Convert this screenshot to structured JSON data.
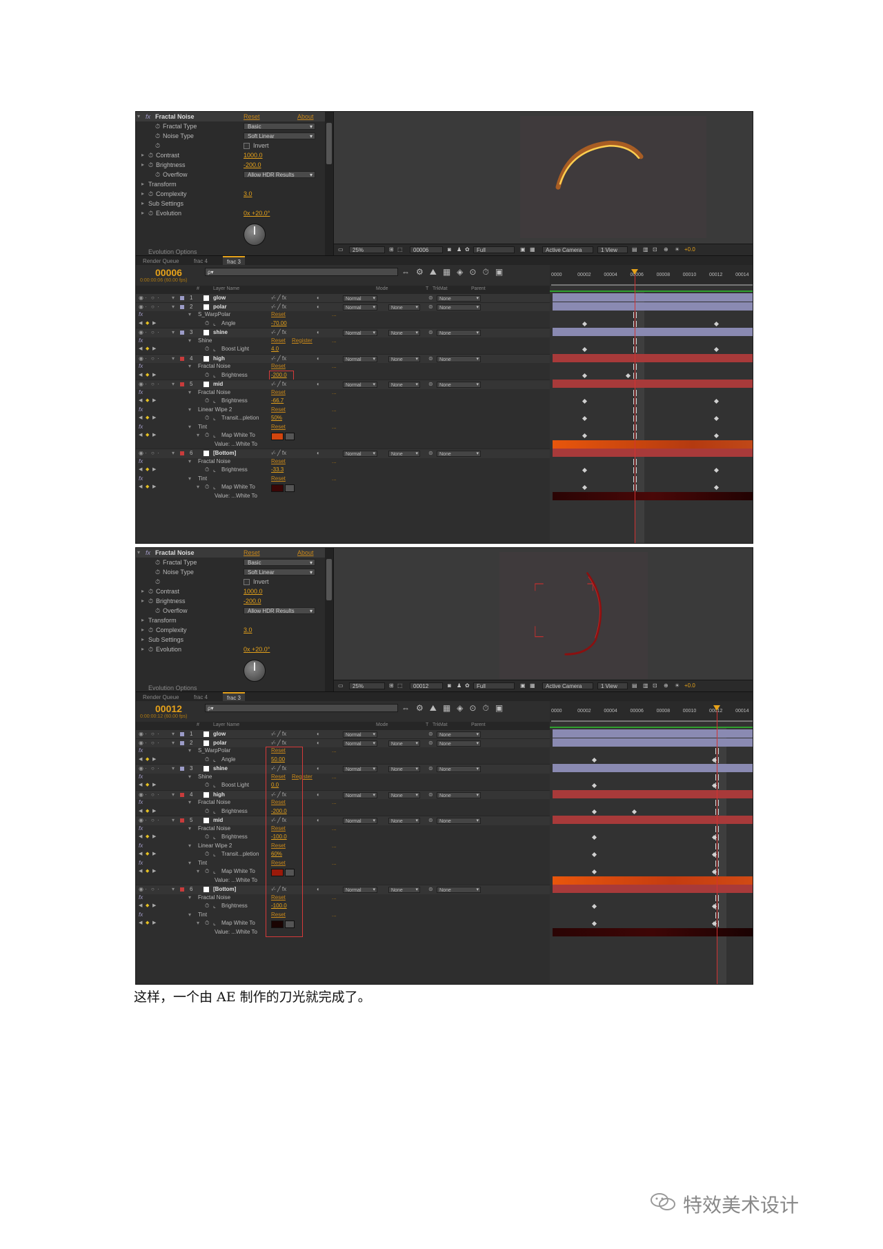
{
  "caption": "这样，一个由 AE 制作的刀光就完成了。",
  "watermark": "特效美术设计",
  "screens": [
    {
      "effect": {
        "title": "Fractal Noise",
        "reset": "Reset",
        "about": "About",
        "fractal_type_label": "Fractal Type",
        "fractal_type": "Basic",
        "noise_type_label": "Noise Type",
        "noise_type": "Soft Linear",
        "invert_label": "Invert",
        "contrast_label": "Contrast",
        "contrast": "1000.0",
        "brightness_label": "Brightness",
        "brightness": "-200.0",
        "overflow_label": "Overflow",
        "overflow": "Allow HDR Results",
        "transform_label": "Transform",
        "complexity_label": "Complexity",
        "complexity": "3.0",
        "sub_settings_label": "Sub Settings",
        "evolution_label": "Evolution",
        "evolution": "0x +20.0°",
        "evolution_options_label": "Evolution Options"
      },
      "viewer": {
        "zoom": "25%",
        "frame": "00006",
        "resolution": "Full",
        "camera": "Active Camera",
        "view": "1 View",
        "exposure": "+0.0"
      },
      "tabs": [
        "Render Queue",
        "frac 4",
        "frac 3"
      ],
      "timeline": {
        "timecode": "00006",
        "timecode_sub": "0:00:00:06 (60.00 fps)",
        "search": "ρ▾",
        "cols": {
          "layer_name": "Layer Name",
          "mode": "Mode",
          "t": "T",
          "trkmat": "TrkMat",
          "parent": "Parent",
          "num": "#"
        },
        "ruler": [
          "0000",
          "00002",
          "00004",
          "00006",
          "00008",
          "00010",
          "00012",
          "00014"
        ],
        "rows": [
          {
            "kind": "layer",
            "num": "1",
            "name": "glow",
            "color": "#9c9cc8",
            "mode": "Normal",
            "trk": "",
            "parent": "None",
            "bar": "#8a8ab2"
          },
          {
            "kind": "layer",
            "num": "2",
            "name": "polar",
            "color": "#9c9cc8",
            "mode": "Normal",
            "trk": "None",
            "parent": "None",
            "bar": "#8a8ab2"
          },
          {
            "kind": "effect",
            "name": "S_WarpPolar",
            "reset": "Reset",
            "extra": "",
            "dots": "..."
          },
          {
            "kind": "prop",
            "name": "Angle",
            "value": "-70.00",
            "kf": [
              0.15,
              0.81
            ]
          },
          {
            "kind": "layer",
            "num": "3",
            "name": "shine",
            "color": "#9c9cc8",
            "mode": "Normal",
            "trk": "None",
            "parent": "None",
            "bar": "#8a8ab2"
          },
          {
            "kind": "effect",
            "name": "Shine",
            "reset": "Reset",
            "extra": "Register",
            "dots": "..."
          },
          {
            "kind": "prop",
            "name": "Boost Light",
            "value": "4.0",
            "kf": [
              0.15,
              0.81
            ]
          },
          {
            "kind": "layer",
            "num": "4",
            "name": "high",
            "color": "#c83c3c",
            "mode": "Normal",
            "trk": "None",
            "parent": "None",
            "bar": "#a83a3a"
          },
          {
            "kind": "effect",
            "name": "Fractal Noise",
            "reset": "Reset",
            "extra": "",
            "dots": "..."
          },
          {
            "kind": "prop",
            "name": "Brightness",
            "value": "-200.0",
            "kf": [
              0.15,
              0.37
            ],
            "boxed": true
          },
          {
            "kind": "layer",
            "num": "5",
            "name": "mid",
            "color": "#c83c3c",
            "mode": "Normal",
            "trk": "None",
            "parent": "None",
            "bar": "#a83a3a"
          },
          {
            "kind": "effect",
            "name": "Fractal Noise",
            "reset": "Reset",
            "extra": "",
            "dots": "..."
          },
          {
            "kind": "prop",
            "name": "Brightness",
            "value": "-66.7",
            "kf": [
              0.15,
              0.81
            ]
          },
          {
            "kind": "effect",
            "name": "Linear Wipe 2",
            "reset": "Reset",
            "extra": "",
            "dots": "..."
          },
          {
            "kind": "prop",
            "name": "Transit...pletion",
            "value": "50%",
            "kf": [
              0.15,
              0.81
            ]
          },
          {
            "kind": "effect",
            "name": "Tint",
            "reset": "Reset",
            "extra": "",
            "dots": "..."
          },
          {
            "kind": "swatch",
            "name": "Map White To",
            "color": "#d2450e",
            "kf": [
              0.15,
              0.81
            ]
          },
          {
            "kind": "valuebar",
            "name": "Value: ...White To",
            "grad": "linear-gradient(90deg,#e8560c,#b43a10 70%,#c04818)"
          },
          {
            "kind": "layer",
            "num": "6",
            "name": "[Bottom]",
            "color": "#c83c3c",
            "mode": "Normal",
            "trk": "None",
            "parent": "None",
            "bar": "#a83a3a"
          },
          {
            "kind": "effect",
            "name": "Fractal Noise",
            "reset": "Reset",
            "extra": "",
            "dots": "..."
          },
          {
            "kind": "prop",
            "name": "Brightness",
            "value": "-33.3",
            "kf": [
              0.15,
              0.81
            ]
          },
          {
            "kind": "effect",
            "name": "Tint",
            "reset": "Reset",
            "extra": "",
            "dots": "..."
          },
          {
            "kind": "swatch",
            "name": "Map White To",
            "color": "#3a0606",
            "kf": [
              0.15,
              0.81
            ]
          },
          {
            "kind": "valuebar",
            "name": "Value: ...White To",
            "grad": "linear-gradient(90deg,#2a0404,#4a0808 50%,#220202)"
          }
        ],
        "cti": 0.41
      }
    },
    {
      "effect": {
        "title": "Fractal Noise",
        "reset": "Reset",
        "about": "About",
        "fractal_type_label": "Fractal Type",
        "fractal_type": "Basic",
        "noise_type_label": "Noise Type",
        "noise_type": "Soft Linear",
        "invert_label": "Invert",
        "contrast_label": "Contrast",
        "contrast": "1000.0",
        "brightness_label": "Brightness",
        "brightness": "-200.0",
        "overflow_label": "Overflow",
        "overflow": "Allow HDR Results",
        "transform_label": "Transform",
        "complexity_label": "Complexity",
        "complexity": "3.0",
        "sub_settings_label": "Sub Settings",
        "evolution_label": "Evolution",
        "evolution": "0x +20.0°",
        "evolution_options_label": "Evolution Options"
      },
      "viewer": {
        "zoom": "25%",
        "frame": "00012",
        "resolution": "Full",
        "camera": "Active Camera",
        "view": "1 View",
        "exposure": "+0.0"
      },
      "tabs": [
        "Render Queue",
        "frac 4",
        "frac 3"
      ],
      "timeline": {
        "timecode": "00012",
        "timecode_sub": "0:00:00:12 (60.00 fps)",
        "search": "ρ▾",
        "cols": {
          "layer_name": "Layer Name",
          "mode": "Mode",
          "t": "T",
          "trkmat": "TrkMat",
          "parent": "Parent",
          "num": "#"
        },
        "ruler": [
          "0000",
          "00002",
          "00004",
          "00006",
          "00008",
          "00010",
          "00012",
          "00014"
        ],
        "rows": [
          {
            "kind": "layer",
            "num": "1",
            "name": "glow",
            "color": "#9c9cc8",
            "mode": "Normal",
            "trk": "",
            "parent": "None",
            "bar": "#8a8ab2"
          },
          {
            "kind": "layer",
            "num": "2",
            "name": "polar",
            "color": "#9c9cc8",
            "mode": "Normal",
            "trk": "None",
            "parent": "None",
            "bar": "#8a8ab2"
          },
          {
            "kind": "effect",
            "name": "S_WarpPolar",
            "reset": "Reset",
            "extra": "",
            "dots": "..."
          },
          {
            "kind": "prop",
            "name": "Angle",
            "value": "50.00",
            "kf": [
              0.2,
              0.8
            ]
          },
          {
            "kind": "layer",
            "num": "3",
            "name": "shine",
            "color": "#9c9cc8",
            "mode": "Normal",
            "trk": "None",
            "parent": "None",
            "bar": "#8a8ab2"
          },
          {
            "kind": "effect",
            "name": "Shine",
            "reset": "Reset",
            "extra": "Register",
            "dots": "..."
          },
          {
            "kind": "prop",
            "name": "Boost Light",
            "value": "0.0",
            "kf": [
              0.2,
              0.8
            ]
          },
          {
            "kind": "layer",
            "num": "4",
            "name": "high",
            "color": "#c83c3c",
            "mode": "Normal",
            "trk": "None",
            "parent": "None",
            "bar": "#a83a3a"
          },
          {
            "kind": "effect",
            "name": "Fractal Noise",
            "reset": "Reset",
            "extra": "",
            "dots": "..."
          },
          {
            "kind": "prop",
            "name": "Brightness",
            "value": "-200.0",
            "kf": [
              0.2,
              0.4
            ]
          },
          {
            "kind": "layer",
            "num": "5",
            "name": "mid",
            "color": "#c83c3c",
            "mode": "Normal",
            "trk": "None",
            "parent": "None",
            "bar": "#a83a3a"
          },
          {
            "kind": "effect",
            "name": "Fractal Noise",
            "reset": "Reset",
            "extra": "",
            "dots": "..."
          },
          {
            "kind": "prop",
            "name": "Brightness",
            "value": "-100.0",
            "kf": [
              0.2,
              0.8
            ]
          },
          {
            "kind": "effect",
            "name": "Linear Wipe 2",
            "reset": "Reset",
            "extra": "",
            "dots": "..."
          },
          {
            "kind": "prop",
            "name": "Transit...pletion",
            "value": "60%",
            "kf": [
              0.2,
              0.8
            ]
          },
          {
            "kind": "effect",
            "name": "Tint",
            "reset": "Reset",
            "extra": "",
            "dots": "..."
          },
          {
            "kind": "swatch",
            "name": "Map White To",
            "color": "#9a1a0a",
            "kf": [
              0.2,
              0.8
            ]
          },
          {
            "kind": "valuebar",
            "name": "Value: ...White To",
            "grad": "linear-gradient(90deg,#e8560c,#c43c10 60%,#d04a14)"
          },
          {
            "kind": "layer",
            "num": "6",
            "name": "[Bottom]",
            "color": "#c83c3c",
            "mode": "Normal",
            "trk": "None",
            "parent": "None",
            "bar": "#a83a3a"
          },
          {
            "kind": "effect",
            "name": "Fractal Noise",
            "reset": "Reset",
            "extra": "",
            "dots": "..."
          },
          {
            "kind": "prop",
            "name": "Brightness",
            "value": "-100.0",
            "kf": [
              0.2,
              0.8
            ]
          },
          {
            "kind": "effect",
            "name": "Tint",
            "reset": "Reset",
            "extra": "",
            "dots": "..."
          },
          {
            "kind": "swatch",
            "name": "Map White To",
            "color": "#1a0402",
            "kf": [
              0.2,
              0.8
            ]
          },
          {
            "kind": "valuebar",
            "name": "Value: ...White To",
            "grad": "linear-gradient(90deg,#2a0404,#3e0606 50%,#1a0202)"
          }
        ],
        "cti": 0.82
      }
    }
  ]
}
